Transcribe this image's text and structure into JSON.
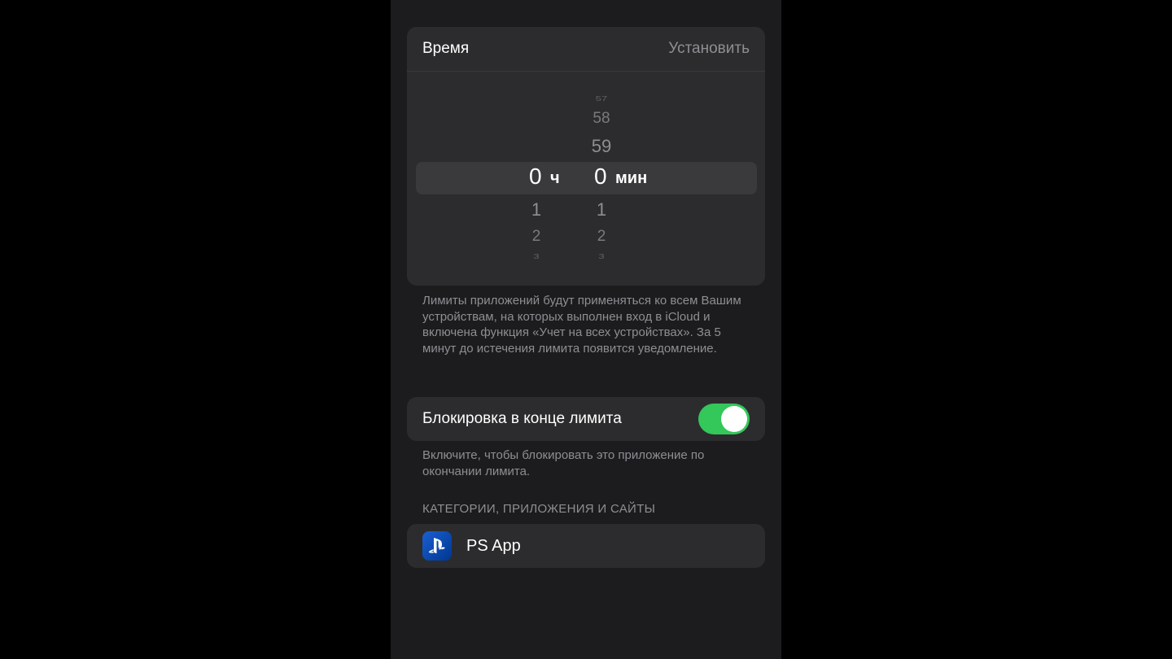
{
  "time_card": {
    "title": "Время",
    "set_label": "Установить",
    "picker": {
      "hours": {
        "above": [],
        "selected": "0",
        "unit": "ч",
        "below": [
          "1",
          "2",
          "3"
        ]
      },
      "minutes": {
        "above": [
          "57",
          "58",
          "59"
        ],
        "selected": "0",
        "unit": "мин",
        "below": [
          "1",
          "2",
          "3"
        ]
      }
    }
  },
  "time_footnote": "Лимиты приложений будут применяться ко всем Вашим устройствам, на которых выполнен вход в iCloud и включена функция «Учет на всех устройствах». За 5 минут до истечения лимита появится уведомление.",
  "block_card": {
    "label": "Блокировка в конце лимита",
    "toggle_on": true,
    "toggle_color": "#34c759"
  },
  "block_footnote": "Включите, чтобы блокировать это приложение по окончании лимита.",
  "apps_section": {
    "header": "КАТЕГОРИИ, ПРИЛОЖЕНИЯ И САЙТЫ",
    "items": [
      {
        "name": "PS App",
        "icon": "playstation-icon",
        "icon_color": "#0047ab"
      }
    ]
  }
}
